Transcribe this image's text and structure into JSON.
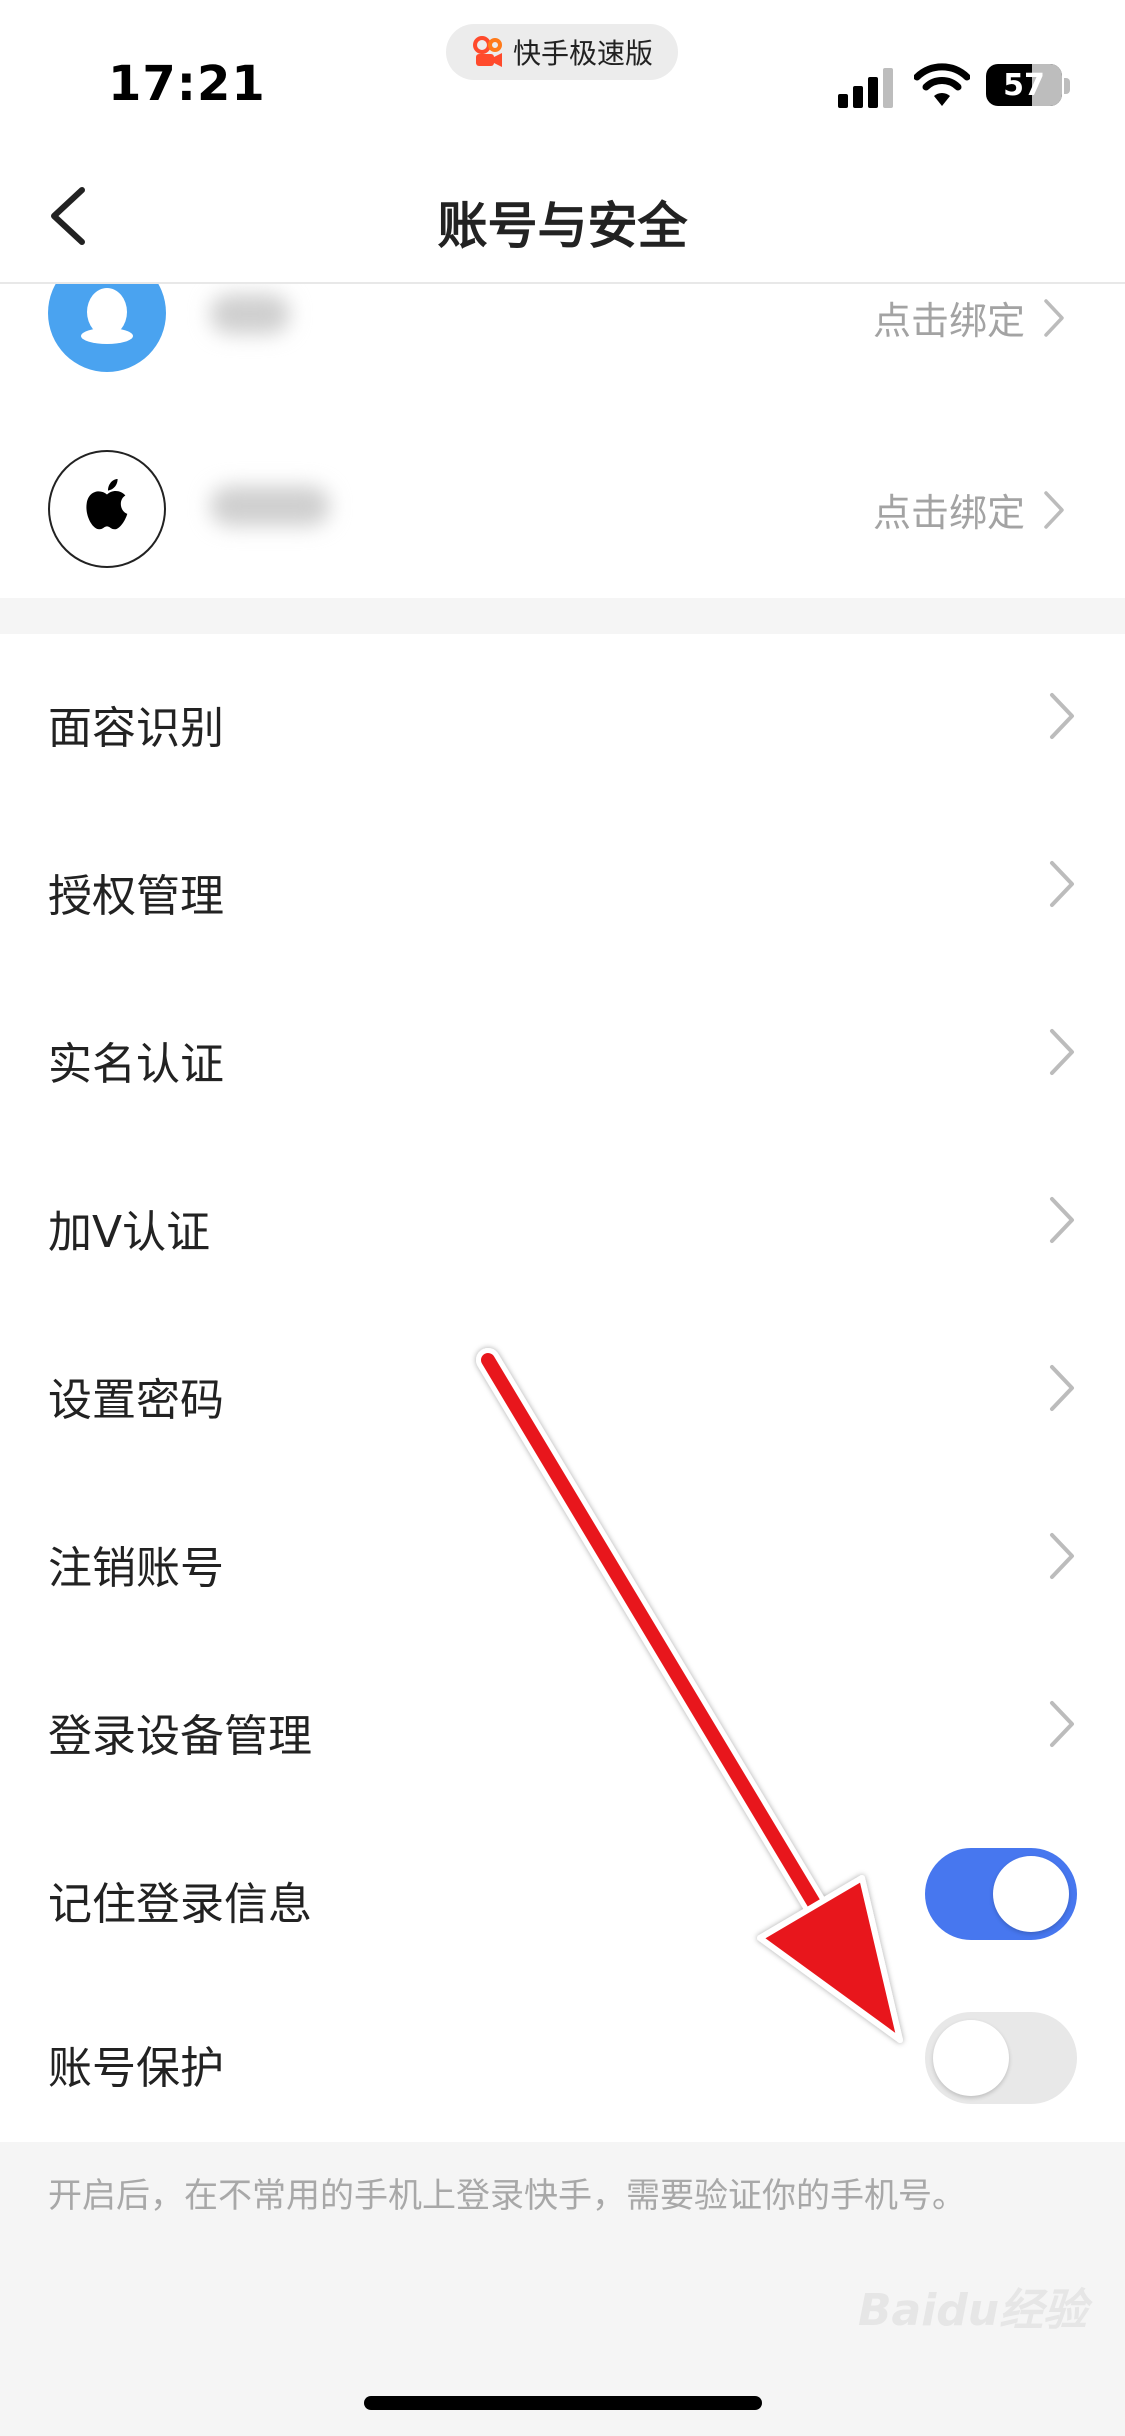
{
  "status_bar": {
    "time": "17:21",
    "app_pill": "快手极速版",
    "battery": "57"
  },
  "nav": {
    "title": "账号与安全"
  },
  "bindings": [
    {
      "service": "qq",
      "action_label": "点击绑定"
    },
    {
      "service": "apple",
      "action_label": "点击绑定"
    }
  ],
  "menu": {
    "items": [
      {
        "label": "面容识别",
        "control": "chevron"
      },
      {
        "label": "授权管理",
        "control": "chevron"
      },
      {
        "label": "实名认证",
        "control": "chevron"
      },
      {
        "label": "加V认证",
        "control": "chevron"
      },
      {
        "label": "设置密码",
        "control": "chevron"
      },
      {
        "label": "注销账号",
        "control": "chevron"
      },
      {
        "label": "登录设备管理",
        "control": "chevron"
      },
      {
        "label": "记住登录信息",
        "control": "toggle",
        "on": true
      },
      {
        "label": "账号保护",
        "control": "toggle",
        "on": false
      }
    ],
    "footnote": "开启后，在不常用的手机上登录快手，需要验证你的手机号。"
  },
  "watermark": "Baidu经验",
  "colors": {
    "accent": "#4777ef",
    "arrow": "#e8161b",
    "qq_blue": "#4aa3f0"
  },
  "icons": [
    "back-arrow-icon",
    "qq-penguin-icon",
    "apple-logo-icon",
    "chevron-right-icon",
    "signal-icon",
    "wifi-icon",
    "battery-icon"
  ]
}
